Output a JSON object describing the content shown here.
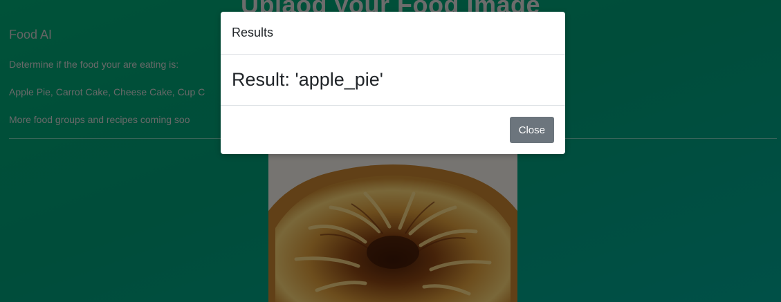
{
  "page": {
    "heading": "Uplaod your Food Image",
    "brand": "Food AI",
    "description_lines": [
      "Determine if the food your are eating is:",
      "Apple Pie, Carrot Cake, Cheese Cake, Cup C",
      "More food groups and recipes coming soo"
    ]
  },
  "modal": {
    "title": "Results",
    "result": "Result: 'apple_pie'",
    "close_label": "Close"
  },
  "colors": {
    "background_green": "#00a472",
    "backdrop": "rgba(0,0,0,0.5)",
    "close_button": "#6c757d"
  }
}
